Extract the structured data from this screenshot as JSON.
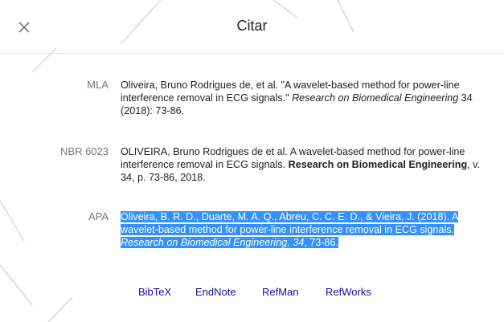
{
  "dialog": {
    "title": "Citar",
    "close_icon": "close-icon"
  },
  "citations": [
    {
      "label": "MLA",
      "parts": [
        {
          "text": "Oliveira, Bruno Rodrigues de, et al. \"A wavelet-based method for power-line interference removal in ECG signals.\" "
        },
        {
          "text": "Research on Biomedical Engineering",
          "style": "italic"
        },
        {
          "text": " 34 (2018): 73-86."
        }
      ]
    },
    {
      "label": "NBR 6023",
      "parts": [
        {
          "text": "OLIVEIRA, Bruno Rodrigues de et al. A wavelet-based method for power-line interference removal in ECG signals. "
        },
        {
          "text": "Research on Biomedical Engineering",
          "style": "bold"
        },
        {
          "text": ", v. 34, p. 73-86, 2018."
        }
      ]
    },
    {
      "label": "APA",
      "selected": true,
      "parts": [
        {
          "text": "Oliveira, B. R. D., Duarte, M. A. Q., Abreu, C. C. E. D., & Vieira, J. (2018). A wavelet-based method for power-line interference removal in ECG signals. "
        },
        {
          "text": "Research on Biomedical Engineering, 34",
          "style": "italic"
        },
        {
          "text": ", 73-86."
        }
      ]
    }
  ],
  "export_links": [
    "BibTeX",
    "EndNote",
    "RefMan",
    "RefWorks"
  ],
  "colors": {
    "link": "#1a0dab",
    "selection": "#3390ff",
    "label": "#777777"
  }
}
